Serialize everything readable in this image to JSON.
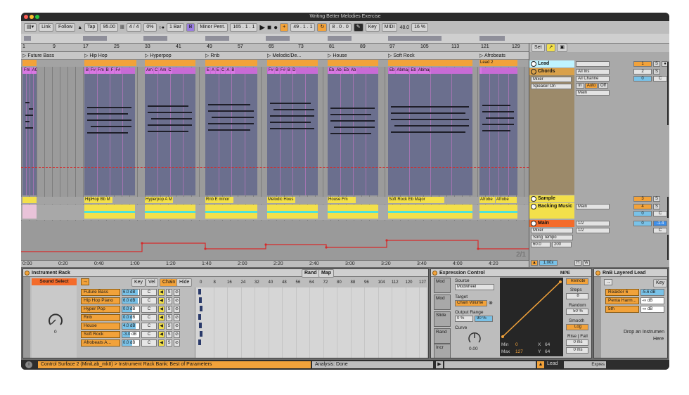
{
  "window": {
    "title": "Writing Better Melodies Exercise"
  },
  "toolbar": {
    "link": "Link",
    "follow": "Follow",
    "tap": "Tap",
    "tempo": "95.00",
    "time_sig": "4 / 4",
    "swing": "0%",
    "metronome": "1 Bar",
    "key": "B",
    "scale": "Minor Pent.",
    "arrangement_pos": "165 . 1 . 1",
    "loop_start": "49 . 1 . 1",
    "loop_length": "8 . 0 . 0",
    "key_map": "Key",
    "midi_map": "MIDI",
    "cpu": "48.0",
    "zoom": "16 %"
  },
  "ruler": {
    "bars": [
      "1",
      "9",
      "17",
      "25",
      "33",
      "41",
      "49",
      "57",
      "65",
      "73",
      "81",
      "89",
      "97",
      "105",
      "113",
      "121",
      "129"
    ]
  },
  "locators": [
    "Future Bass",
    "Hip Hop",
    "Hyperpop",
    "Rnb",
    "Melodic/De...",
    "House",
    "Soft Rock",
    "Afrobeats"
  ],
  "lead_clip_label": "Lead 2",
  "chord_clip_labels": [
    [
      "Fm",
      "AC"
    ],
    [
      "B",
      "F#",
      "Fm",
      "B",
      "F",
      "F#"
    ],
    [
      "Am",
      "C",
      "Am",
      "C"
    ],
    [
      "E",
      "A",
      "E",
      "C",
      "A",
      "B"
    ],
    [
      "F#",
      "B",
      "F#",
      "B",
      "D"
    ],
    [
      "Eb",
      "Ab",
      "Eb",
      "Ab"
    ],
    [
      "Eb",
      "Abmaj",
      "Eb",
      "Abmaj"
    ],
    [
      ""
    ]
  ],
  "sample_clips": [
    "HipHop Bb M",
    "Hyperpop A M",
    "Rnb E minor",
    "Melodic Hous",
    "House Fm",
    "Soft Rock Eb Major",
    "Afrobe",
    "Afrobe"
  ],
  "time_labels": [
    "0:00",
    "0:20",
    "0:40",
    "1:00",
    "1:20",
    "1:40",
    "2:00",
    "2:20",
    "2:40",
    "3:00",
    "3:20",
    "3:40",
    "4:00",
    "4:20"
  ],
  "bottom_right": {
    "zoom": "1.00x",
    "h": "H",
    "w": "W",
    "beat": "2/1"
  },
  "mixer": {
    "set_label": "Set",
    "tracks": [
      {
        "name": "Lead",
        "number": "1",
        "s": "S"
      },
      {
        "name": "Chords",
        "number": "2",
        "s": "S",
        "input": "All Ins",
        "channel": "All Channe",
        "monitor_in": "In",
        "monitor_auto": "Auto",
        "monitor_off": "Off",
        "out": "Main",
        "vol": "0",
        "pan": "C",
        "device": "Mixer",
        "speaker": "Speaker On"
      },
      {
        "name": "Sample",
        "number": "3",
        "s": "S"
      },
      {
        "name": "Backing Music",
        "number": "4",
        "s": "S",
        "out": "Main",
        "vol": "0",
        "pan": "C"
      },
      {
        "name": "Main",
        "vol": "0",
        "level": "-1.4",
        "split1": "1/2",
        "split2": "1/2",
        "pan": "C",
        "device": "Mixer",
        "tempo_device": "Song Tempo",
        "tempo_min": "60.0",
        "tempo_max": "200"
      }
    ]
  },
  "instrument_rack": {
    "title": "Instrument Rack",
    "sound_select": "Sound Select",
    "knob_value": "0",
    "tabs": [
      "Key",
      "Vel",
      "Chain",
      "Hide"
    ],
    "rand": "Rand",
    "map": "Map",
    "zone_ticks": [
      "0",
      "8",
      "16",
      "24",
      "32",
      "40",
      "48",
      "56",
      "64",
      "72",
      "80",
      "88",
      "96",
      "104",
      "112",
      "120",
      "127"
    ],
    "chains": [
      {
        "name": "Future Bass",
        "vol": "6.0 dB",
        "pan": "C",
        "fill": 0.9
      },
      {
        "name": "Hip Hop Piano",
        "vol": "6.0 dB",
        "pan": "C",
        "fill": 0.9
      },
      {
        "name": "Hyper Pop",
        "vol": "0.0 dB",
        "pan": "C",
        "fill": 0.6
      },
      {
        "name": "Rnb",
        "vol": "0.0 dB",
        "pan": "C",
        "fill": 0.6
      },
      {
        "name": "House",
        "vol": "4.0 dB",
        "pan": "C",
        "fill": 0.8
      },
      {
        "name": "Soft Rock",
        "vol": "-3.0 dB",
        "pan": "C",
        "fill": 0.45
      },
      {
        "name": "Afrobeats A...",
        "vol": "0.0 dB",
        "pan": "C",
        "fill": 0.6
      }
    ],
    "chain_buttons": [
      "M",
      "S",
      "R"
    ]
  },
  "expression": {
    "title": "Expression Control",
    "mpe": "MPE",
    "tabs": [
      "Mod",
      "Mod",
      "Slide",
      "Rand",
      "Incr"
    ],
    "source_label": "Source",
    "source": "Modwheel",
    "target_label": "Target",
    "target": "Chain Volume",
    "range_label": "Output Range",
    "range_min": "0 %",
    "range_max": "90 %",
    "curve_label": "Curve",
    "curve_value": "0.00",
    "min_label": "Min",
    "min": "0",
    "max_label": "Max",
    "max": "127",
    "x_label": "X",
    "x": "64",
    "y_label": "Y",
    "y": "64",
    "remote": "Remote",
    "steps_label": "Steps",
    "steps": "8",
    "random_label": "Random",
    "random": "50 %",
    "smooth_label": "Smooth",
    "smooth": "Log",
    "rise_label": "Rise | Fall",
    "rise": "0 ms",
    "fall": "0 ms"
  },
  "rnb_layered": {
    "title": "RnB Layered Lead",
    "key": "Key",
    "chains": [
      {
        "name": "Reaktor 6",
        "vol": "-5.6 dB"
      },
      {
        "name": "Penta Harm...",
        "vol": "-∞ dB"
      },
      {
        "name": "5th",
        "vol": "-∞ dB"
      }
    ],
    "drop_hint_1": "Drop an Instrumen",
    "drop_hint_2": "Here"
  },
  "status": {
    "message": "Control Surface 2 (MiniLab_mkII) > Instrument Rack Bank: Best of Parameters",
    "analysis": "Analysis: Done",
    "lead": "Lead",
    "express": "Expres"
  },
  "colors": {
    "orange": "#f2a23a",
    "midi_clip": "#6b6f8e",
    "chord_clip": "#8a5f7e",
    "yellow": "#f3e04a",
    "cyan": "#4fe3d8",
    "automation": "#d62a2a",
    "lead_track": "#bff4ff"
  }
}
